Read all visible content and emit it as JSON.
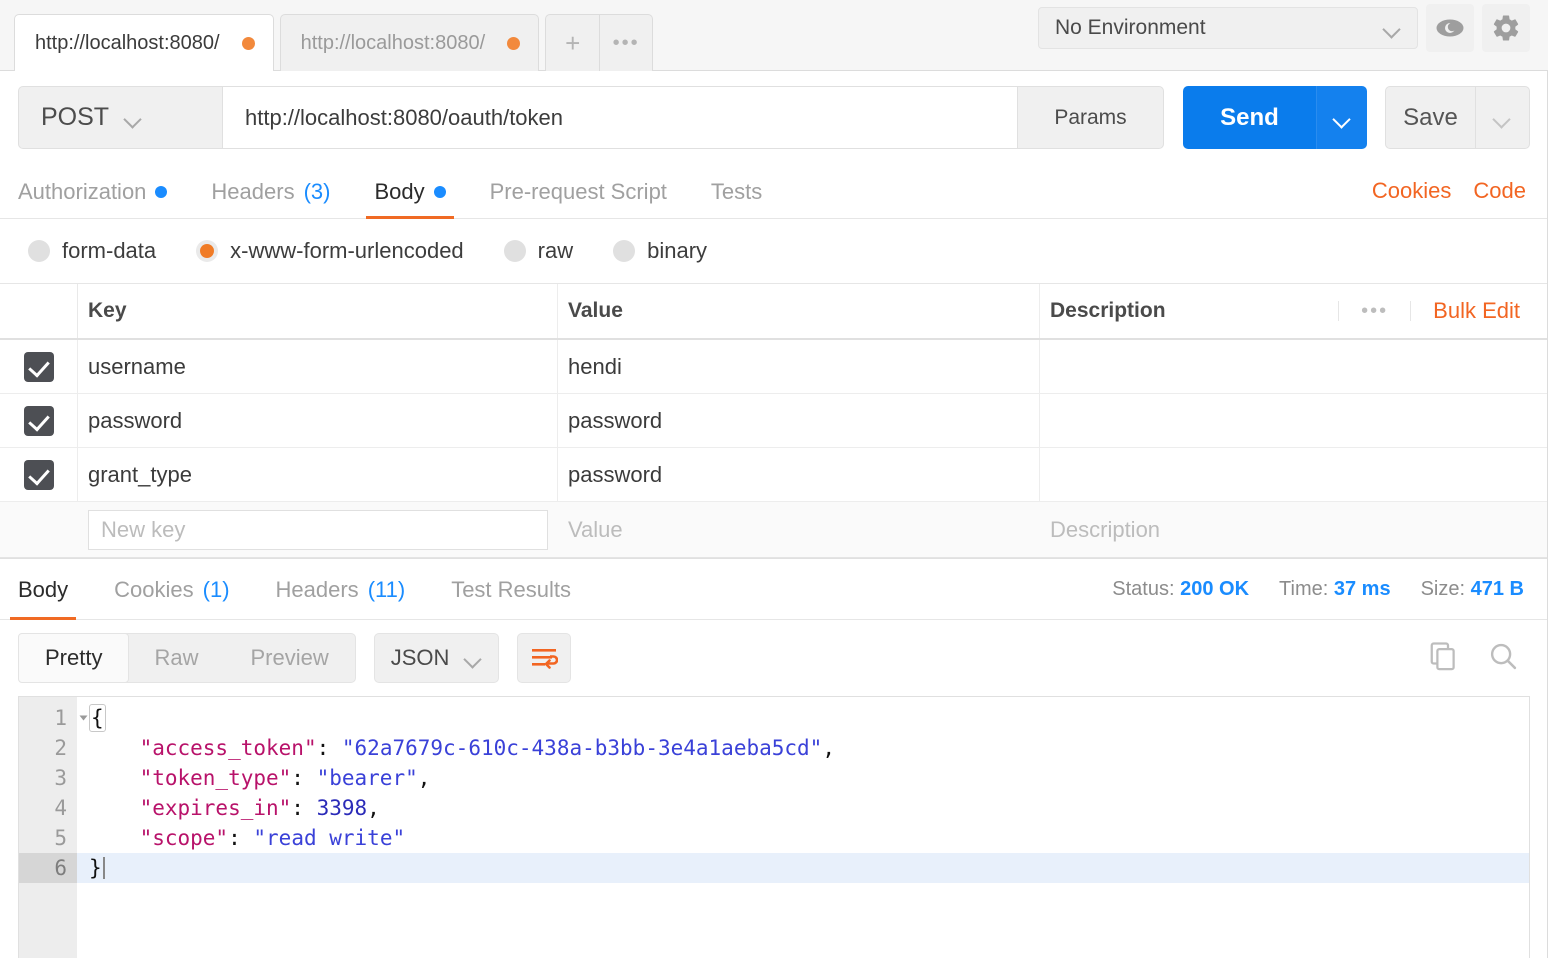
{
  "tabbar": {
    "tabs": [
      {
        "label": "http://localhost:8080/",
        "active": true,
        "unsaved": true
      },
      {
        "label": "http://localhost:8080/",
        "active": false,
        "unsaved": true
      }
    ],
    "new_tab_label": "+",
    "more_label": "•••",
    "environment": {
      "selected": "No Environment",
      "eye_icon": "eye-icon",
      "settings_icon": "gear-icon"
    }
  },
  "urlbar": {
    "method": "POST",
    "url": "http://localhost:8080/oauth/token",
    "params_label": "Params",
    "send_label": "Send",
    "save_label": "Save"
  },
  "request_tabs": {
    "items": [
      {
        "label": "Authorization",
        "badge_dot": true,
        "count": "",
        "active": false
      },
      {
        "label": "Headers",
        "badge_dot": false,
        "count": "(3)",
        "active": false
      },
      {
        "label": "Body",
        "badge_dot": true,
        "count": "",
        "active": true
      },
      {
        "label": "Pre-request Script",
        "badge_dot": false,
        "count": "",
        "active": false
      },
      {
        "label": "Tests",
        "badge_dot": false,
        "count": "",
        "active": false
      }
    ],
    "cookies_label": "Cookies",
    "code_label": "Code"
  },
  "body_types": [
    {
      "label": "form-data",
      "selected": false
    },
    {
      "label": "x-www-form-urlencoded",
      "selected": true
    },
    {
      "label": "raw",
      "selected": false
    },
    {
      "label": "binary",
      "selected": false
    }
  ],
  "kv_table": {
    "headers": {
      "key": "Key",
      "value": "Value",
      "description": "Description"
    },
    "more_label": "•••",
    "bulk_edit_label": "Bulk Edit",
    "rows": [
      {
        "checked": true,
        "key": "username",
        "value": "hendi",
        "description": ""
      },
      {
        "checked": true,
        "key": "password",
        "value": "password",
        "description": ""
      },
      {
        "checked": true,
        "key": "grant_type",
        "value": "password",
        "description": ""
      }
    ],
    "new_row": {
      "key_placeholder": "New key",
      "value_placeholder": "Value",
      "description_placeholder": "Description"
    }
  },
  "response_tabs": {
    "items": [
      {
        "label": "Body",
        "count": "",
        "active": true
      },
      {
        "label": "Cookies",
        "count": "(1)",
        "active": false
      },
      {
        "label": "Headers",
        "count": "(11)",
        "active": false
      },
      {
        "label": "Test Results",
        "count": "",
        "active": false
      }
    ],
    "stats": {
      "status_label": "Status:",
      "status_value": "200 OK",
      "time_label": "Time:",
      "time_value": "37 ms",
      "size_label": "Size:",
      "size_value": "471 B"
    }
  },
  "view_toolbar": {
    "modes": [
      {
        "label": "Pretty",
        "active": true
      },
      {
        "label": "Raw",
        "active": false
      },
      {
        "label": "Preview",
        "active": false
      }
    ],
    "format": "JSON",
    "wrap_icon": "word-wrap-icon",
    "copy_icon": "copy-icon",
    "search_icon": "search-icon"
  },
  "response_body": {
    "language": "json",
    "active_line": 6,
    "lines": [
      {
        "n": "1",
        "foldable": true,
        "tokens": [
          {
            "t": "brace",
            "v": "{"
          }
        ]
      },
      {
        "n": "2",
        "foldable": false,
        "tokens": [
          {
            "t": "indent",
            "v": "    "
          },
          {
            "t": "key",
            "v": "\"access_token\""
          },
          {
            "t": "pun",
            "v": ": "
          },
          {
            "t": "str",
            "v": "\"62a7679c-610c-438a-b3bb-3e4a1aeba5cd\""
          },
          {
            "t": "pun",
            "v": ","
          }
        ]
      },
      {
        "n": "3",
        "foldable": false,
        "tokens": [
          {
            "t": "indent",
            "v": "    "
          },
          {
            "t": "key",
            "v": "\"token_type\""
          },
          {
            "t": "pun",
            "v": ": "
          },
          {
            "t": "str",
            "v": "\"bearer\""
          },
          {
            "t": "pun",
            "v": ","
          }
        ]
      },
      {
        "n": "4",
        "foldable": false,
        "tokens": [
          {
            "t": "indent",
            "v": "    "
          },
          {
            "t": "key",
            "v": "\"expires_in\""
          },
          {
            "t": "pun",
            "v": ": "
          },
          {
            "t": "num",
            "v": "3398"
          },
          {
            "t": "pun",
            "v": ","
          }
        ]
      },
      {
        "n": "5",
        "foldable": false,
        "tokens": [
          {
            "t": "indent",
            "v": "    "
          },
          {
            "t": "key",
            "v": "\"scope\""
          },
          {
            "t": "pun",
            "v": ": "
          },
          {
            "t": "str",
            "v": "\"read write\""
          }
        ]
      },
      {
        "n": "6",
        "foldable": false,
        "tokens": [
          {
            "t": "pun",
            "v": "}"
          }
        ]
      }
    ]
  },
  "colors": {
    "accent_orange": "#f26522",
    "link_blue": "#1a8cff",
    "send_blue": "#0a7cec",
    "json_key": "#b8126a",
    "json_string": "#3a41d8",
    "json_number": "#2a2ab8",
    "checkbox_dark": "#4d4f54"
  }
}
